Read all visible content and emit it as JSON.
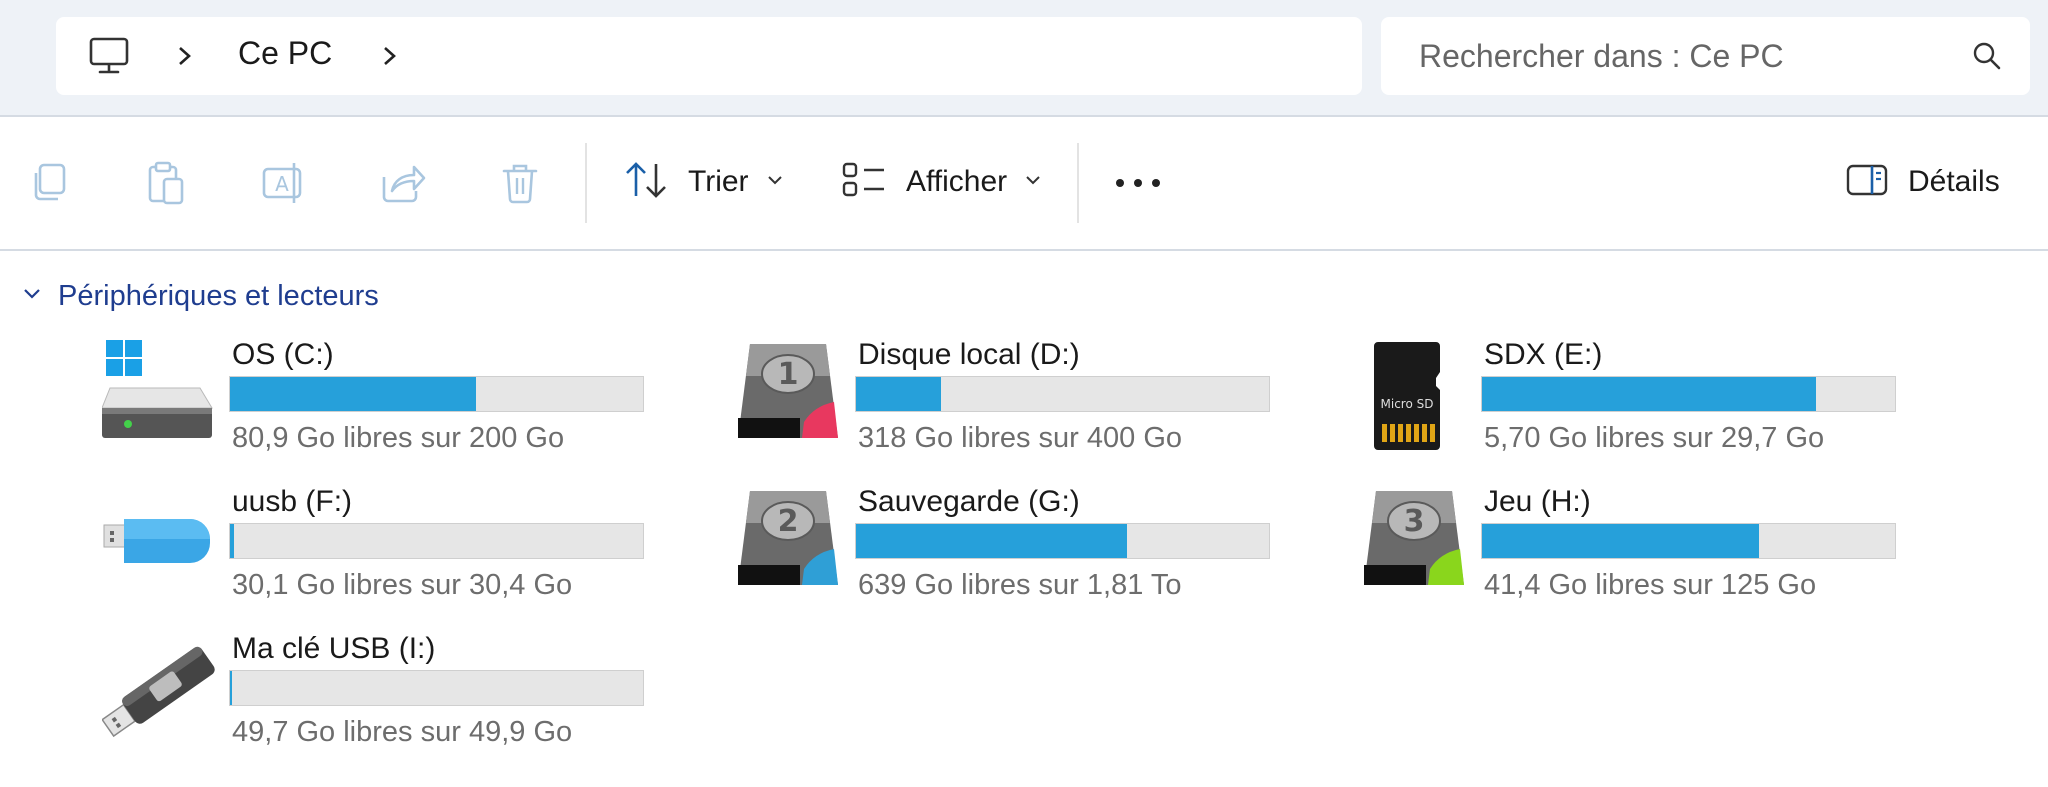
{
  "address": {
    "crumbs": [
      "Ce PC"
    ]
  },
  "search": {
    "placeholder": "Rechercher dans : Ce PC"
  },
  "toolbar": {
    "sort_label": "Trier",
    "view_label": "Afficher",
    "details_label": "Détails"
  },
  "section": {
    "title": "Périphériques et lecteurs"
  },
  "colors": {
    "accent_bar": "#26a0da",
    "bar_track": "#e6e6e6",
    "section_title": "#1f3d8f"
  },
  "drives": [
    {
      "name": "OS (C:)",
      "free_text": "80,9 Go libres sur 200 Go",
      "used_fraction": 0.595,
      "icon": "windows-drive-icon"
    },
    {
      "name": "Disque local (D:)",
      "free_text": "318 Go libres sur 400 Go",
      "used_fraction": 0.205,
      "icon": "hdd-1-icon"
    },
    {
      "name": "SDX (E:)",
      "free_text": "5,70 Go libres sur 29,7 Go",
      "used_fraction": 0.808,
      "icon": "microsd-icon"
    },
    {
      "name": "uusb (F:)",
      "free_text": "30,1 Go libres sur 30,4 Go",
      "used_fraction": 0.01,
      "icon": "usb-stick-blue-icon"
    },
    {
      "name": "Sauvegarde (G:)",
      "free_text": "639 Go libres sur 1,81 To",
      "used_fraction": 0.655,
      "icon": "hdd-2-icon"
    },
    {
      "name": "Jeu (H:)",
      "free_text": "41,4 Go libres sur 125 Go",
      "used_fraction": 0.67,
      "icon": "hdd-3-icon"
    },
    {
      "name": "Ma clé USB (I:)",
      "free_text": "49,7 Go libres sur 49,9 Go",
      "used_fraction": 0.004,
      "icon": "usb-key-icon"
    }
  ],
  "microsd_label": "Micro SD"
}
